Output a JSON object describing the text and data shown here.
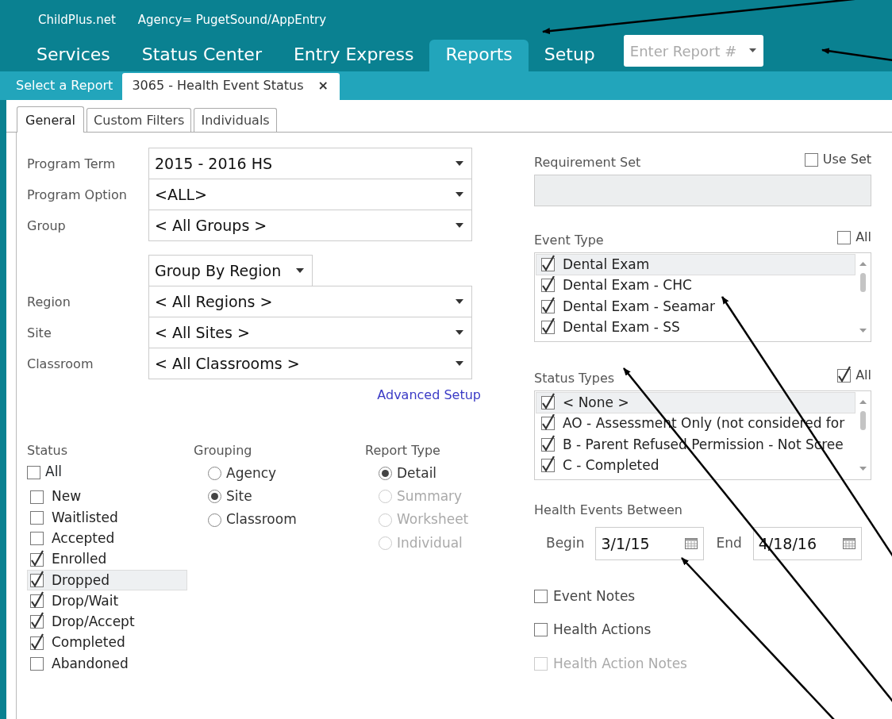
{
  "header": {
    "app": "ChildPlus.net",
    "agency": "Agency= PugetSound/AppEntry"
  },
  "nav": [
    {
      "label": "Services",
      "selected": false
    },
    {
      "label": "Status Center",
      "selected": false
    },
    {
      "label": "Entry Express",
      "selected": false
    },
    {
      "label": "Reports",
      "selected": true
    },
    {
      "label": "Setup",
      "selected": false
    }
  ],
  "report_search": {
    "placeholder": "Enter Report #"
  },
  "report_tabs": [
    {
      "label": "Select a Report",
      "selected": false
    },
    {
      "label": "3065 - Health Event Status",
      "close": "×",
      "selected": true
    }
  ],
  "form_tabs": [
    {
      "label": "General",
      "selected": true
    },
    {
      "label": "Custom Filters",
      "selected": false
    },
    {
      "label": "Individuals",
      "selected": false
    }
  ],
  "filters": [
    {
      "label": "Program Term",
      "value": "2015 - 2016 HS"
    },
    {
      "label": "Program Option",
      "value": "<ALL>"
    },
    {
      "label": "Group",
      "value": "< All Groups >"
    }
  ],
  "group_by": {
    "value": "Group By Region"
  },
  "location_filters": [
    {
      "label": "Region",
      "value": "< All Regions >"
    },
    {
      "label": "Site",
      "value": "< All Sites >"
    },
    {
      "label": "Classroom",
      "value": "< All Classrooms >"
    }
  ],
  "advanced_setup": "Advanced Setup",
  "status": {
    "title": "Status",
    "all": {
      "label": "All",
      "checked": false
    },
    "items": [
      {
        "label": "New",
        "checked": false,
        "selected": false
      },
      {
        "label": "Waitlisted",
        "checked": false,
        "selected": false
      },
      {
        "label": "Accepted",
        "checked": false,
        "selected": false
      },
      {
        "label": "Enrolled",
        "checked": true,
        "selected": false
      },
      {
        "label": "Dropped",
        "checked": true,
        "selected": true
      },
      {
        "label": "Drop/Wait",
        "checked": true,
        "selected": false
      },
      {
        "label": "Drop/Accept",
        "checked": true,
        "selected": false
      },
      {
        "label": "Completed",
        "checked": true,
        "selected": false
      },
      {
        "label": "Abandoned",
        "checked": false,
        "selected": false
      }
    ]
  },
  "grouping": {
    "title": "Grouping",
    "options": [
      {
        "label": "Agency",
        "selected": false
      },
      {
        "label": "Site",
        "selected": true
      },
      {
        "label": "Classroom",
        "selected": false
      }
    ]
  },
  "report_type": {
    "title": "Report Type",
    "options": [
      {
        "label": "Detail",
        "selected": true,
        "disabled": false
      },
      {
        "label": "Summary",
        "selected": false,
        "disabled": true
      },
      {
        "label": "Worksheet",
        "selected": false,
        "disabled": true
      },
      {
        "label": "Individual",
        "selected": false,
        "disabled": true
      }
    ]
  },
  "requirement_set": {
    "label": "Requirement Set",
    "use_set": {
      "label": "Use Set",
      "checked": false
    }
  },
  "event_type": {
    "label": "Event Type",
    "all": {
      "label": "All",
      "checked": false
    },
    "items": [
      {
        "label": "Dental Exam",
        "checked": true,
        "selected": true
      },
      {
        "label": "Dental Exam - CHC",
        "checked": true,
        "selected": false
      },
      {
        "label": "Dental Exam - Seamar",
        "checked": true,
        "selected": false
      },
      {
        "label": "Dental Exam - SS",
        "checked": true,
        "selected": false
      }
    ]
  },
  "status_types": {
    "label": "Status Types",
    "all": {
      "label": "All",
      "checked": true
    },
    "items": [
      {
        "label": "< None >",
        "checked": true,
        "selected": true
      },
      {
        "label": "AO - Assessment Only (not considered for",
        "checked": true,
        "selected": false
      },
      {
        "label": "B - Parent Refused Permission - Not Scree",
        "checked": true,
        "selected": false
      },
      {
        "label": "C - Completed",
        "checked": true,
        "selected": false
      }
    ]
  },
  "date_range": {
    "label": "Health Events Between",
    "begin": {
      "label": "Begin",
      "value": "3/1/15"
    },
    "end": {
      "label": "End",
      "value": "4/18/16"
    }
  },
  "options": [
    {
      "label": "Event Notes",
      "checked": false,
      "disabled": false
    },
    {
      "label": "Health Actions",
      "checked": false,
      "disabled": false
    },
    {
      "label": "Health Action Notes",
      "checked": false,
      "disabled": true
    }
  ]
}
